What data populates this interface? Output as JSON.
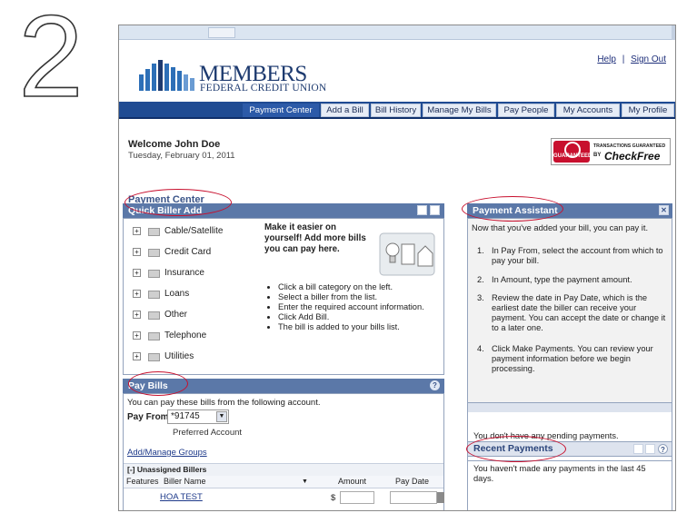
{
  "step_number": "2",
  "header": {
    "brand_main": "MEMBERS",
    "brand_sub": "FEDERAL CREDIT UNION",
    "help": "Help",
    "separator": "|",
    "sign_out": "Sign Out"
  },
  "nav": [
    "Payment Center",
    "Add a Bill",
    "Bill History",
    "Manage My Bills",
    "Pay People",
    "My Accounts",
    "My Profile"
  ],
  "welcome": {
    "greeting": "Welcome John Doe",
    "date": "Tuesday, February 01, 2011"
  },
  "badge": {
    "seal_text": "GUARANTEED",
    "transactions": "TRANSACTIONS GUARANTEED",
    "by": "BY",
    "brand": "CheckFree"
  },
  "payment_center": {
    "title": "Payment Center"
  },
  "quick_biller_add": {
    "title": "Quick Biller Add",
    "categories": [
      "Cable/Satellite",
      "Credit Card",
      "Insurance",
      "Loans",
      "Other",
      "Telephone",
      "Utilities"
    ],
    "prompt": "Make it easier on yourself! Add more bills you can pay here.",
    "bullets": [
      "Click a bill category on the left.",
      "Select a biller from the list.",
      "Enter the required account information.",
      "Click Add Bill.",
      "The bill is added to your bills list."
    ]
  },
  "pay_bills": {
    "title": "Pay Bills",
    "intro": "You can pay these bills from the following account.",
    "pay_from_label": "Pay From",
    "account": "*91745",
    "account_note": "Preferred Account",
    "add_manage_groups": "Add/Manage Groups",
    "group": "[-]  Unassigned Billers",
    "columns": [
      "Features",
      "Biller Name",
      "Amount",
      "Pay Date"
    ],
    "rows": [
      {
        "biller": "HOA TEST",
        "currency": "$"
      }
    ]
  },
  "payment_assistant": {
    "title": "Payment Assistant",
    "intro": "Now that you've added your bill, you can pay it.",
    "steps": [
      {
        "n": "1.",
        "text": "In Pay From, select the account from which to pay your bill."
      },
      {
        "n": "2.",
        "text": "In Amount, type the payment amount."
      },
      {
        "n": "3.",
        "text": "Review the date in Pay Date, which is the earliest date the biller can receive your payment. You can accept the date or change it to a later one."
      },
      {
        "n": "4.",
        "text": "Click Make Payments. You can review your payment information before we begin processing."
      }
    ]
  },
  "pending": {
    "text": "You don't have any pending payments."
  },
  "recent_payments": {
    "title": "Recent Payments",
    "text": "You haven't made any payments in the last 45 days."
  },
  "colors": {
    "nav_bg": "#1f4b93",
    "panel_header": "#5b78a8",
    "brand": "#1d3a6f",
    "annotation": "#c8102e"
  }
}
